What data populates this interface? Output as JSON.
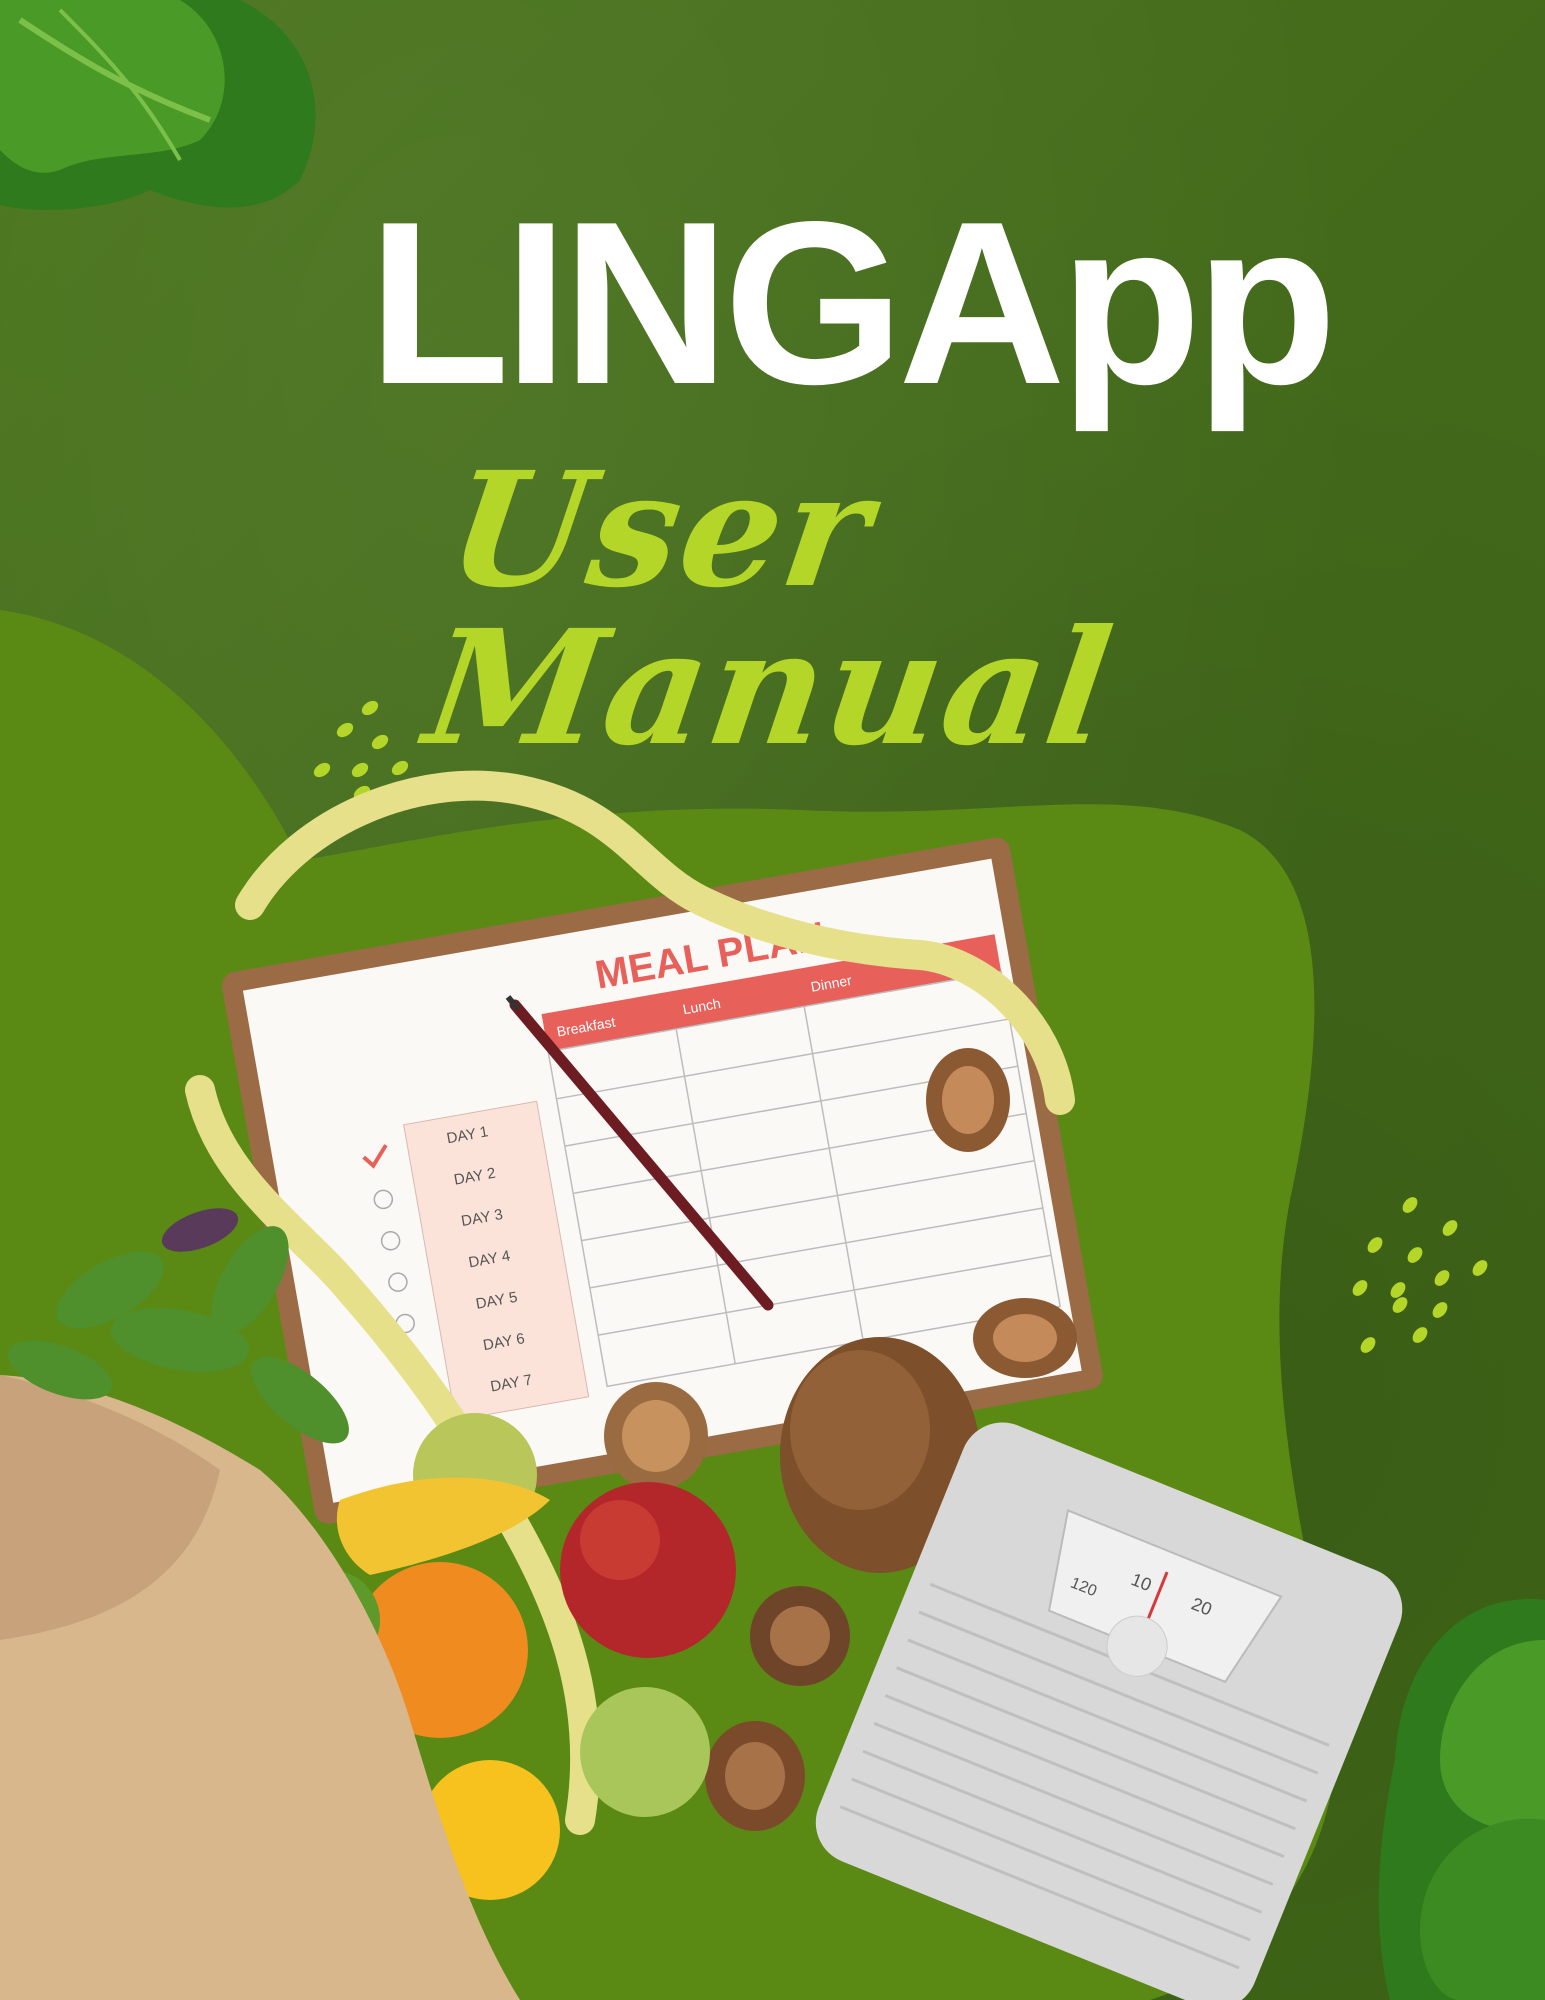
{
  "cover": {
    "title": "LINGApp",
    "subtitle": "User Manual"
  },
  "meal_plan": {
    "heading": "MEAL PLAN",
    "columns": [
      "Breakfast",
      "Lunch",
      "Dinner"
    ],
    "days": [
      "DAY 1",
      "DAY 2",
      "DAY 3",
      "DAY 4",
      "DAY 5",
      "DAY 6",
      "DAY 7"
    ]
  },
  "scale": {
    "ticks": [
      "10",
      "20",
      "120"
    ]
  },
  "colors": {
    "background": "#46701a",
    "blob": "#5a8a14",
    "title": "#ffffff",
    "subtitle": "#b4d628",
    "accent_red": "#e8605a"
  }
}
